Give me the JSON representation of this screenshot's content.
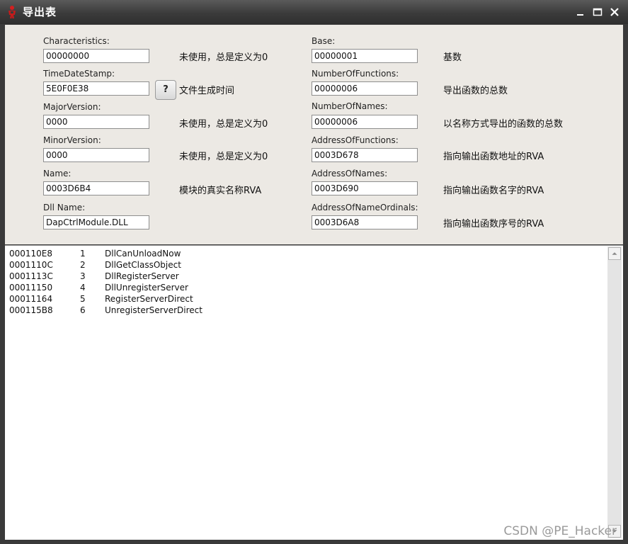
{
  "window": {
    "title": "导出表"
  },
  "left_fields": [
    {
      "label": "Characteristics:",
      "value": "00000000",
      "desc": "未使用，总是定义为0"
    },
    {
      "label": "TimeDateStamp:",
      "value": "5E0F0E38",
      "desc": "文件生成时间"
    },
    {
      "label": "MajorVersion:",
      "value": "0000",
      "desc": "未使用，总是定义为0"
    },
    {
      "label": "MinorVersion:",
      "value": "0000",
      "desc": "未使用，总是定义为0"
    },
    {
      "label": "Name:",
      "value": "0003D6B4",
      "desc": "模块的真实名称RVA"
    },
    {
      "label": "Dll Name:",
      "value": "DapCtrlModule.DLL",
      "desc": ""
    }
  ],
  "right_fields": [
    {
      "label": "Base:",
      "value": "00000001",
      "desc": "基数"
    },
    {
      "label": "NumberOfFunctions:",
      "value": "00000006",
      "desc": "导出函数的总数"
    },
    {
      "label": "NumberOfNames:",
      "value": "00000006",
      "desc": "以名称方式导出的函数的总数"
    },
    {
      "label": "AddressOfFunctions:",
      "value": "0003D678",
      "desc": "指向输出函数地址的RVA"
    },
    {
      "label": "AddressOfNames:",
      "value": "0003D690",
      "desc": "指向输出函数名字的RVA"
    },
    {
      "label": "AddressOfNameOrdinals:",
      "value": "0003D6A8",
      "desc": "指向输出函数序号的RVA"
    }
  ],
  "help_button": {
    "label": "?"
  },
  "exports": [
    {
      "rva": "000110E8",
      "ordinal": "1",
      "name": "DllCanUnloadNow"
    },
    {
      "rva": "0001110C",
      "ordinal": "2",
      "name": "DllGetClassObject"
    },
    {
      "rva": "0001113C",
      "ordinal": "3",
      "name": "DllRegisterServer"
    },
    {
      "rva": "00011150",
      "ordinal": "4",
      "name": "DllUnregisterServer"
    },
    {
      "rva": "00011164",
      "ordinal": "5",
      "name": "RegisterServerDirect"
    },
    {
      "rva": "000115B8",
      "ordinal": "6",
      "name": "UnregisterServerDirect"
    }
  ],
  "watermark": "CSDN @PE_Hacker",
  "icons": {
    "app": "red-figure-icon",
    "minimize": "minimize-icon",
    "maximize": "maximize-icon",
    "close": "close-icon"
  }
}
